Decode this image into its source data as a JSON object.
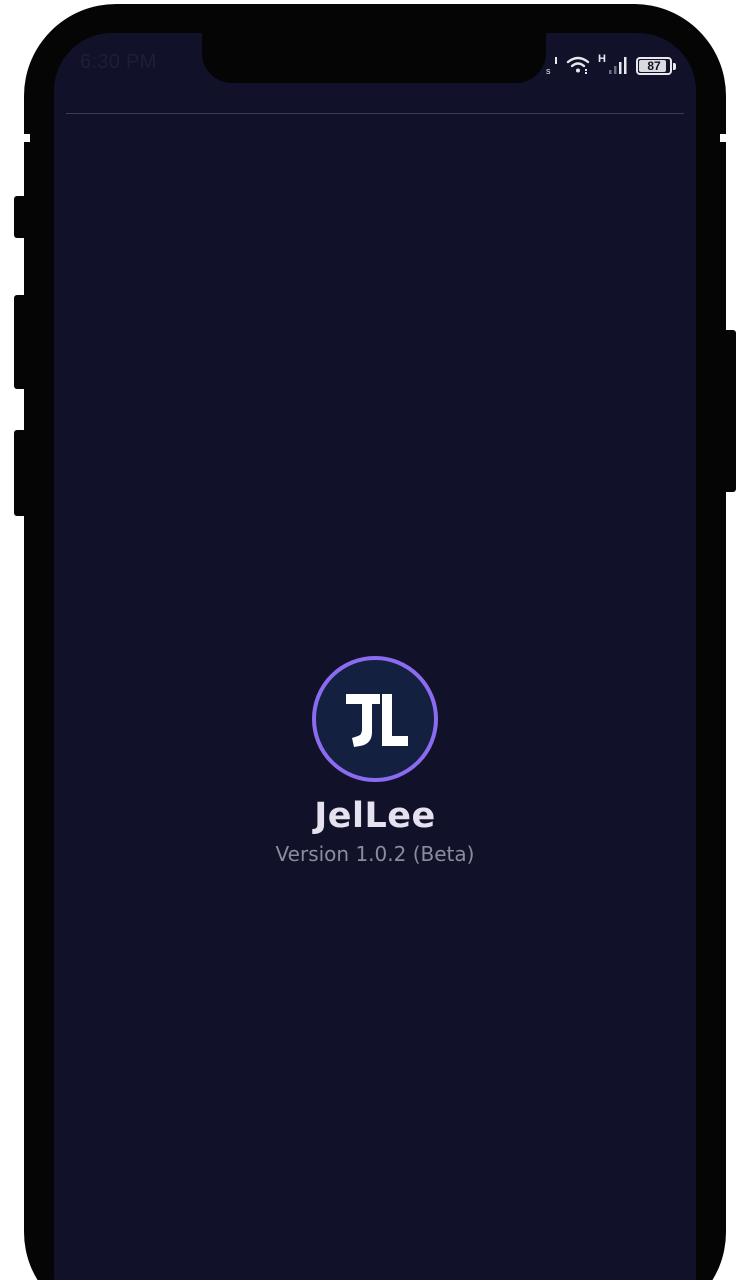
{
  "status_bar": {
    "time": "6:30 PM",
    "network_type": "H",
    "battery_level": "87"
  },
  "splash": {
    "app_name": "JelLee",
    "version": "Version 1.0.2 (Beta)",
    "logo_icon": "jellee-logo-icon"
  },
  "colors": {
    "background": "#11122a",
    "logo_ring": "#8b6cf0",
    "logo_fill": "#13203f"
  }
}
